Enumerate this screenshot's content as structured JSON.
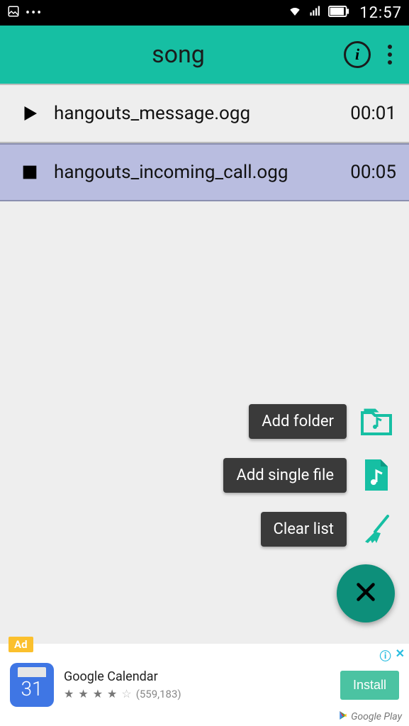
{
  "statusbar": {
    "time": "12:57"
  },
  "appbar": {
    "title": "song"
  },
  "tracks": [
    {
      "name": "hangouts_message.ogg",
      "duration": "00:01",
      "playing": false
    },
    {
      "name": "hangouts_incoming_call.ogg",
      "duration": "00:05",
      "playing": true
    }
  ],
  "fab": {
    "add_folder": "Add folder",
    "add_file": "Add single file",
    "clear": "Clear list"
  },
  "ad": {
    "badge": "Ad",
    "icon_number": "31",
    "title": "Google Calendar",
    "rating_count": "(559,183)",
    "install": "Install",
    "store": "Google Play"
  },
  "colors": {
    "accent": "#16bfa3",
    "fab_main": "#0d8f7a",
    "selected_row": "#b9bde0"
  }
}
